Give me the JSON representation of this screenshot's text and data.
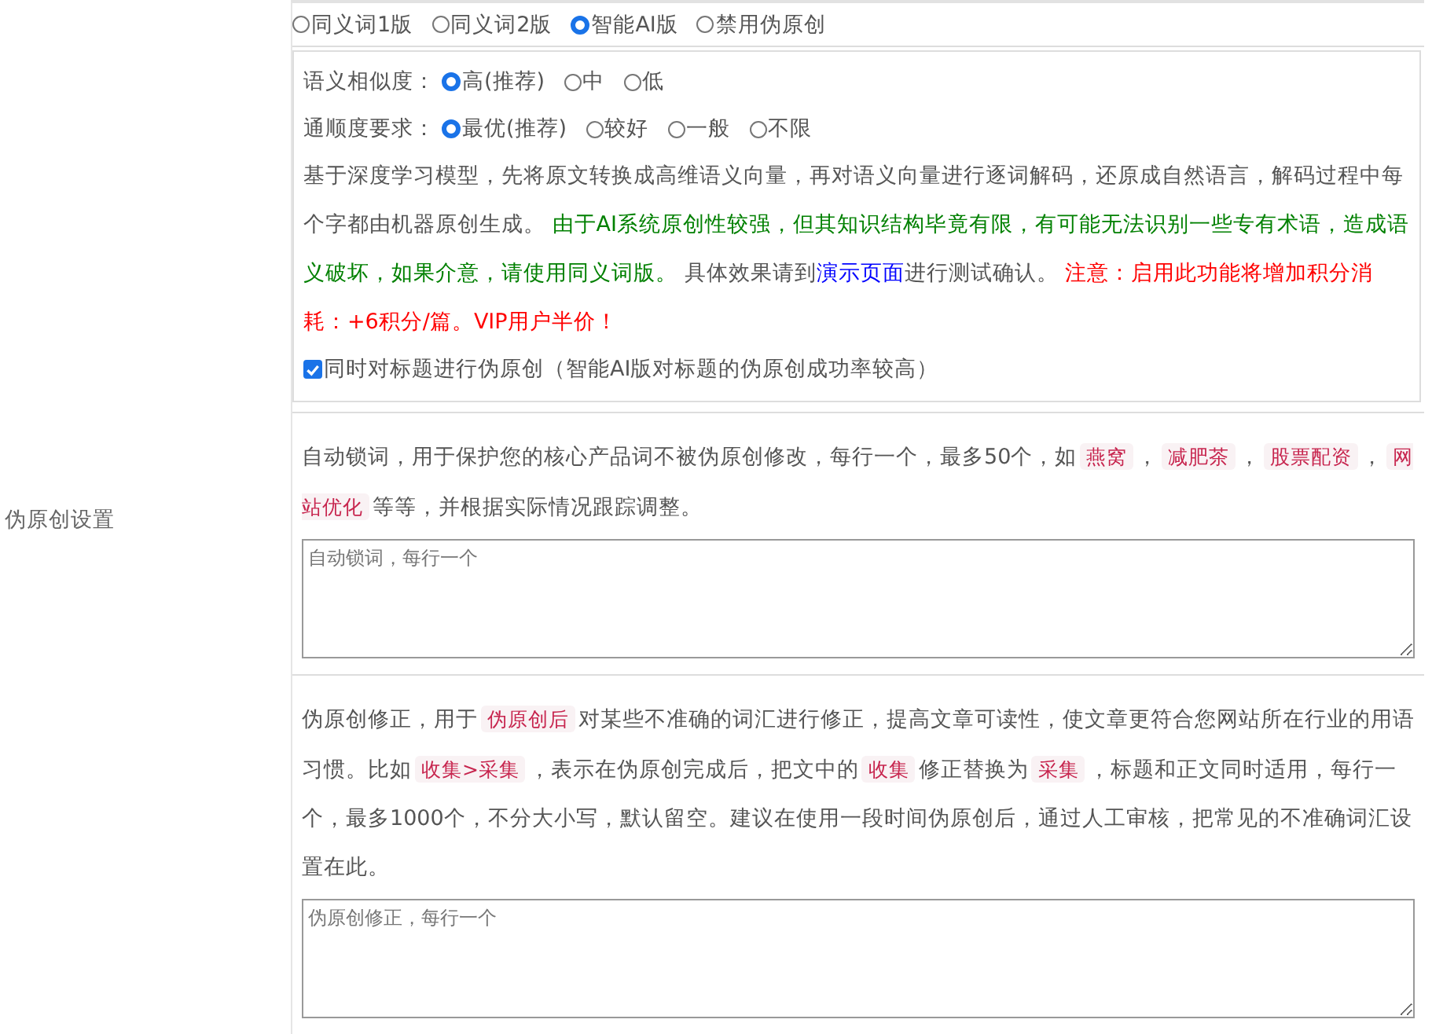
{
  "section_label": "伪原创设置",
  "modes": [
    {
      "label": "同义词1版",
      "selected": false
    },
    {
      "label": "同义词2版",
      "selected": false
    },
    {
      "label": "智能AI版",
      "selected": true
    },
    {
      "label": "禁用伪原创",
      "selected": false
    }
  ],
  "ai_panel": {
    "similarity": {
      "label": "语义相似度：",
      "options": [
        {
          "label": "高(推荐)",
          "selected": true
        },
        {
          "label": "中",
          "selected": false
        },
        {
          "label": "低",
          "selected": false
        }
      ]
    },
    "fluency": {
      "label": "通顺度要求：",
      "options": [
        {
          "label": "最优(推荐)",
          "selected": true
        },
        {
          "label": "较好",
          "selected": false
        },
        {
          "label": "一般",
          "selected": false
        },
        {
          "label": "不限",
          "selected": false
        }
      ]
    },
    "description": [
      {
        "kind": "plain",
        "text": "基于深度学习模型，先将原文转换成高维语义向量，再对语义向量进行逐词解码，还原成自然语言，解码过程中每个字都由机器原创生成。 "
      },
      {
        "kind": "green",
        "text": "由于AI系统原创性较强，但其知识结构毕竟有限，有可能无法识别一些专有术语，造成语义破坏，如果介意，请使用同义词版。"
      },
      {
        "kind": "plain",
        "text": " 具体效果请到"
      },
      {
        "kind": "link",
        "text": "演示页面"
      },
      {
        "kind": "plain",
        "text": "进行测试确认。 "
      },
      {
        "kind": "red",
        "text": "注意：启用此功能将增加积分消耗：+6积分/篇。VIP用户半价！"
      }
    ],
    "title_option": {
      "label": "同时对标题进行伪原创（智能AI版对标题的伪原创成功率较高）",
      "checked": true
    }
  },
  "lock_words": {
    "description": [
      {
        "kind": "plain",
        "text": "自动锁词，用于保护您的核心产品词不被伪原创修改，每行一个，最多50个，如"
      },
      {
        "kind": "code",
        "text": "燕窝"
      },
      {
        "kind": "plain",
        "text": "，"
      },
      {
        "kind": "code",
        "text": "减肥茶"
      },
      {
        "kind": "plain",
        "text": "，"
      },
      {
        "kind": "code",
        "text": "股票配资"
      },
      {
        "kind": "plain",
        "text": "，"
      },
      {
        "kind": "code",
        "text": "网站优化"
      },
      {
        "kind": "plain",
        "text": "等等，并根据实际情况跟踪调整。"
      }
    ],
    "placeholder": "自动锁词，每行一个"
  },
  "corrections": {
    "description": [
      {
        "kind": "plain",
        "text": "伪原创修正，用于"
      },
      {
        "kind": "code",
        "text": "伪原创后"
      },
      {
        "kind": "plain",
        "text": "对某些不准确的词汇进行修正，提高文章可读性，使文章更符合您网站所在行业的用语习惯。比如"
      },
      {
        "kind": "code",
        "text": "收集>采集"
      },
      {
        "kind": "plain",
        "text": "，表示在伪原创完成后，把文中的"
      },
      {
        "kind": "code",
        "text": "收集"
      },
      {
        "kind": "plain",
        "text": "修正替换为"
      },
      {
        "kind": "code",
        "text": "采集"
      },
      {
        "kind": "plain",
        "text": "，标题和正文同时适用，每行一个，最多1000个，不分大小写，默认留空。建议在使用一段时间伪原创后，通过人工审核，把常见的不准确词汇设置在此。"
      }
    ],
    "placeholder": "伪原创修正，每行一个"
  }
}
